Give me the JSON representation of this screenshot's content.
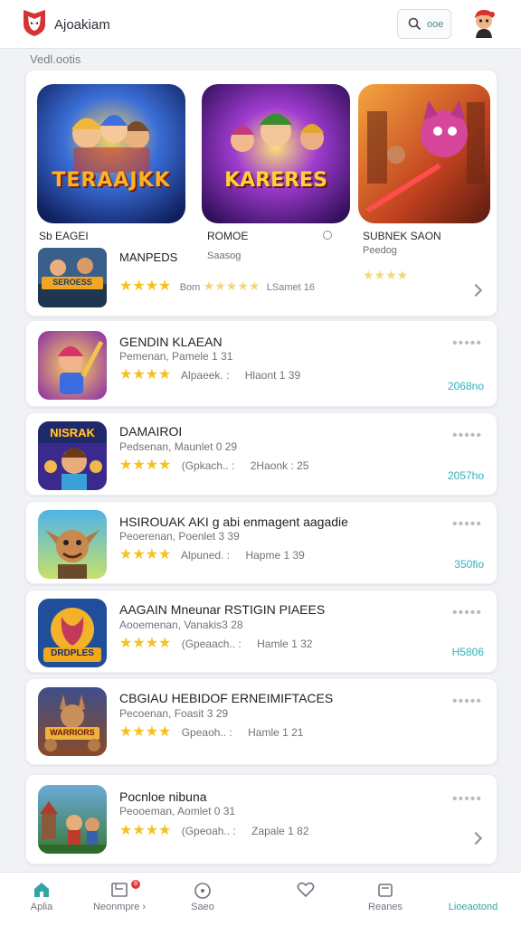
{
  "header": {
    "title": "Ajoakiam",
    "search_label": "ooe"
  },
  "section_label": "Vedl.ootis",
  "featured": {
    "tiles": [
      {
        "art_text": "TERAAJKK",
        "name": "Sb EAGEI",
        "icon": "heroes-banner"
      },
      {
        "art_text": "KARERES",
        "name": "ROMOE",
        "sub": "Saasog",
        "icon": "villains-banner"
      },
      {
        "art_text": "",
        "name": "SUBNEK SAON",
        "sub": "Peedog",
        "icon": "robot-cat-banner"
      }
    ],
    "inline": {
      "title": "MANPEDS",
      "mini_art_text": "SEROESS",
      "rating_text": "Bom",
      "extra_text": "LSamet 16"
    },
    "rating_stars": "★★★★",
    "pale_stars": "★★★★★"
  },
  "apps": [
    {
      "title": "GENDIN KLAEAN",
      "meta": "Pemenan, Pamele 1 31",
      "rating_label": "Alpaeek. :",
      "detail": "Hlaont 1 39",
      "price": "2068no",
      "icon": "brawler-girl-icon"
    },
    {
      "title": "DAMAIROI",
      "meta": "Pedsenan, Maunlet 0 29",
      "rating_label": "(Gpkach.. :",
      "detail": "2Haonk : 25",
      "price": "2057ho",
      "icon": "nisrak-hero-icon"
    },
    {
      "title": "HSIROUAK AKI g abi enmagent aagadie",
      "meta": "Peoerenan, Poenlet 3 39",
      "rating_label": "Alpuned. :",
      "detail": "Hapme 1 39",
      "price": "350fio",
      "icon": "goblin-warrior-icon"
    },
    {
      "title": "AAGAIN Mneunar RSTIGIN PIAEES",
      "meta": "Aooemenan, Vanakis3 28",
      "rating_label": "(Gpeaach.. :",
      "detail": "Hamle 1 32",
      "price": "H5806",
      "icon": "drops-shield-icon"
    },
    {
      "title": "CBGIAU HEBIDOF ERNEIMIFTACES",
      "meta": "Pecoenan, Foasit 3 29",
      "rating_label": "Gpeaoh.. :",
      "detail": "Hamle 1 21",
      "price": "",
      "icon": "kangaroo-warriors-icon"
    },
    {
      "title": "Pocnloe nibuna",
      "meta": "Peooeman, Aomlet 0 31",
      "rating_label": "(Gpeoah.. :",
      "detail": "Zapale 1 82",
      "price": "",
      "icon": "village-battle-icon"
    }
  ],
  "stars": "★★★★",
  "more_dots": "•••••",
  "nav": [
    {
      "label": "Aplia",
      "icon": "home-icon",
      "active": false
    },
    {
      "label": "Neonmpre ›",
      "icon": "inbox-icon",
      "badge": "9",
      "active": false
    },
    {
      "label": "Saeo",
      "icon": "compass-icon",
      "active": false
    },
    {
      "label": "",
      "icon": "heart-icon",
      "active": false
    },
    {
      "label": "Reanes",
      "icon": "library-icon",
      "active": false
    },
    {
      "label": "Lioeaotond",
      "icon": "",
      "active": true
    }
  ]
}
